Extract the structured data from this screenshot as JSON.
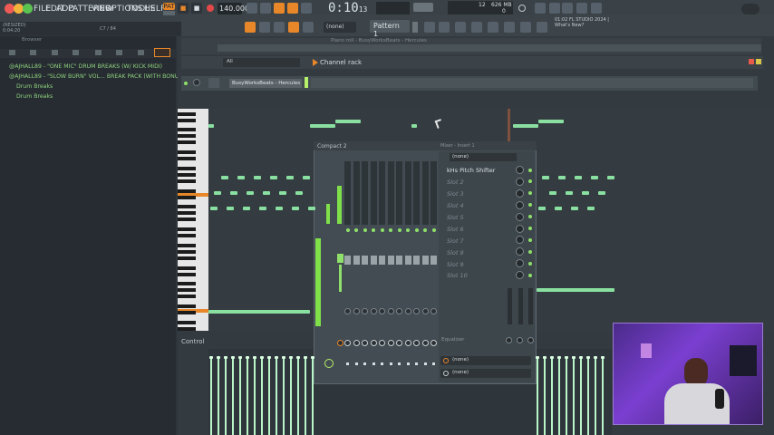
{
  "window": {
    "traffic_lights": [
      "#ee5b57",
      "#f3b33b",
      "#5bc451"
    ]
  },
  "menu": [
    "FILE",
    "EDIT",
    "ADD",
    "PATTERNS",
    "VIEW",
    "OPTIONS",
    "TOOLS",
    "HELP"
  ],
  "transport": {
    "mode_label": "PAT",
    "tempo": "140.000",
    "time_main": "0:10",
    "time_sub": "13",
    "pattern": "Pattern 1",
    "snap": "(none)",
    "cpu": "12",
    "ram": "626 MB",
    "ram_sub": "0"
  },
  "hint": {
    "line1": "(RESIZED)",
    "line2": "0:04:20",
    "right": "C7 / 84"
  },
  "news": {
    "line1": "01:02  FL STUDIO 2024 |",
    "line2": "What's New?"
  },
  "browser": {
    "title": "Browser",
    "items": [
      "@AJHALL89 - \"ONE MIC\" DRUM BREAKS (W/ KICK MIDI)",
      "@AJHALL89 - \"SLOW BURN\" VOL... BREAK PACK (WITH BONUS SHOTS)",
      "Drum Breaks",
      "Drum Breaks"
    ]
  },
  "playlist": {
    "title": "Piano roll - BusyWorksBeats - Hercules"
  },
  "channel_rack": {
    "title": "Channel rack",
    "filter": "All",
    "channel_name": "BusyWorksBeats - Hercules"
  },
  "mixer": {
    "title": "Compact 2",
    "fx_header": "Mixer - Insert 1",
    "preset": "(none)",
    "slots": [
      "kHs Pitch Shifter",
      "Slot 2",
      "Slot 3",
      "Slot 4",
      "Slot 5",
      "Slot 6",
      "Slot 7",
      "Slot 8",
      "Slot 9",
      "Slot 10"
    ],
    "eq_label": "Equalizer",
    "out1": "(none)",
    "out2": "(none)"
  },
  "piano_roll": {
    "control_label": "Control"
  },
  "colors": {
    "accent_orange": "#e8872a",
    "note_green": "#8ae0a0",
    "meter_green": "#7fe04a"
  }
}
